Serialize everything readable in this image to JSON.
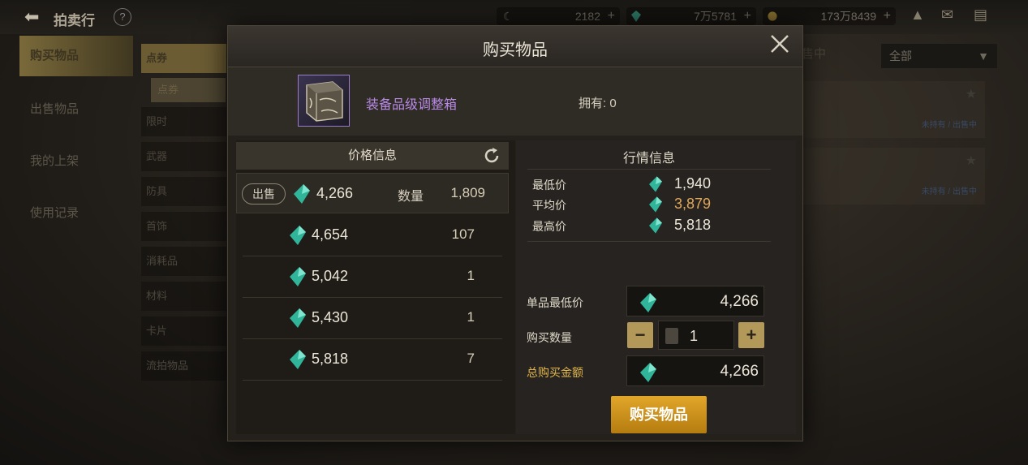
{
  "topbar": {
    "title": "拍卖行",
    "currencies": [
      {
        "icon": "coupon-icon",
        "value": "2182"
      },
      {
        "icon": "gem-icon",
        "value": "7万5781"
      },
      {
        "icon": "gold-coin-icon",
        "value": "173万8439"
      }
    ]
  },
  "sidebar": {
    "items": [
      {
        "label": "购买物品",
        "active": true
      },
      {
        "label": "出售物品"
      },
      {
        "label": "我的上架"
      },
      {
        "label": "使用记录"
      }
    ]
  },
  "categories": {
    "items": [
      "点券",
      "限时",
      "武器",
      "防具",
      "首饰",
      "消耗品",
      "材料",
      "卡片",
      "流拍物品"
    ],
    "sub_item": "点券"
  },
  "background_list": {
    "header_partial": "售中",
    "filter_value": "全部",
    "status_text": "未持有 / 出售中"
  },
  "modal": {
    "title": "购买物品",
    "item_name": "装备品级调整箱",
    "own_text": "拥有: 0",
    "price_panel": {
      "title": "价格信息",
      "sale_badge": "出售",
      "qty_label": "数量",
      "rows": [
        {
          "price": "4,266",
          "qty": "1,809"
        },
        {
          "price": "4,654",
          "qty": "107"
        },
        {
          "price": "5,042",
          "qty": "1"
        },
        {
          "price": "5,430",
          "qty": "1"
        },
        {
          "price": "5,818",
          "qty": "7"
        }
      ]
    },
    "market": {
      "title": "行情信息",
      "min_label": "最低价",
      "min_value": "1,940",
      "avg_label": "平均价",
      "avg_value": "3,879",
      "max_label": "最高价",
      "max_value": "5,818"
    },
    "purchase": {
      "unit_label": "单品最低价",
      "unit_value": "4,266",
      "qty_label": "购买数量",
      "qty_value": "1",
      "total_label": "总购买金额",
      "total_value": "4,266",
      "buy_button": "购买物品"
    },
    "accent_colors": {
      "gold": "#e1a629",
      "item_purple": "#b98ae6",
      "avg_orange": "#e1a85a"
    }
  }
}
